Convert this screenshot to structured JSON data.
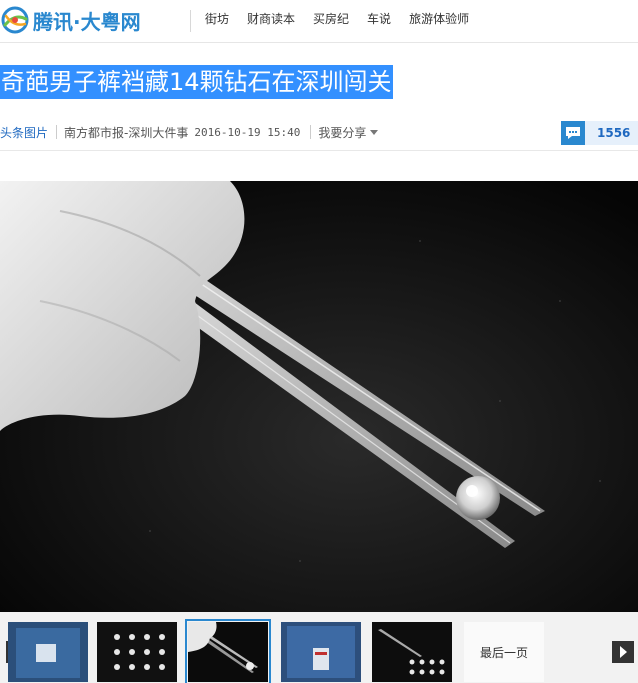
{
  "header": {
    "logo_text": "腾讯·大粤网",
    "nav": [
      {
        "label": "街坊"
      },
      {
        "label": "财商读本"
      },
      {
        "label": "买房纪"
      },
      {
        "label": "车说"
      },
      {
        "label": "旅游体验师"
      }
    ]
  },
  "article": {
    "title": "奇葩男子裤裆藏14颗钻石在深圳闯关",
    "tag": "头条图片",
    "source": "南方都市报-深圳大件事",
    "time": "2016-10-19 15:40",
    "share_label": "我要分享",
    "comment_count": "1556"
  },
  "gallery": {
    "last_page_label": "最后一页"
  },
  "colors": {
    "brand_blue": "#2a88cf",
    "title_highlight": "#3390ff",
    "link_blue": "#1e68c0"
  }
}
